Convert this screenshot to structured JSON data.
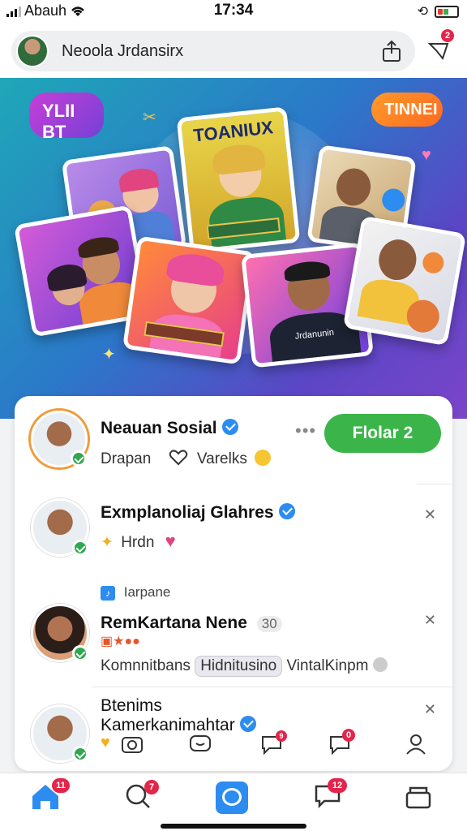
{
  "status_bar": {
    "carrier": "Abauh",
    "time": "17:34"
  },
  "header": {
    "profile_name": "Neoola Jrdansirx",
    "notification_count": "2"
  },
  "hero": {
    "bubble_left": "YLII BT",
    "bubble_right": "TINNEI",
    "card_title": "TOANIUX",
    "card_shirt_text": "Jrdanunin"
  },
  "feed": {
    "items": [
      {
        "name": "Neauan Sosial",
        "action_label": "Drapan",
        "reaction_label": "Varelks",
        "follow_label": "Flolar 2"
      },
      {
        "name": "Exmplanoliaj Glahres",
        "meta_label": "Hrdn"
      },
      {
        "header_label": "Iarpane",
        "name": "RemKartana Nene",
        "count": "30",
        "meta_left": "Komnnitbans",
        "meta_chip": "Hidnitusino",
        "meta_right": "VintalKinpm"
      },
      {
        "name_line1": "Btenims",
        "name_line2": "Kamerkanimahtar"
      }
    ],
    "action_badge": "9",
    "action_badge_2": "0"
  },
  "bottom_nav": {
    "home_badge": "11",
    "search_badge": "7",
    "messages_badge": "12"
  },
  "colors": {
    "accent_green": "#3bb54a",
    "badge_red": "#e4254a",
    "verified_blue": "#2d8cf0"
  }
}
